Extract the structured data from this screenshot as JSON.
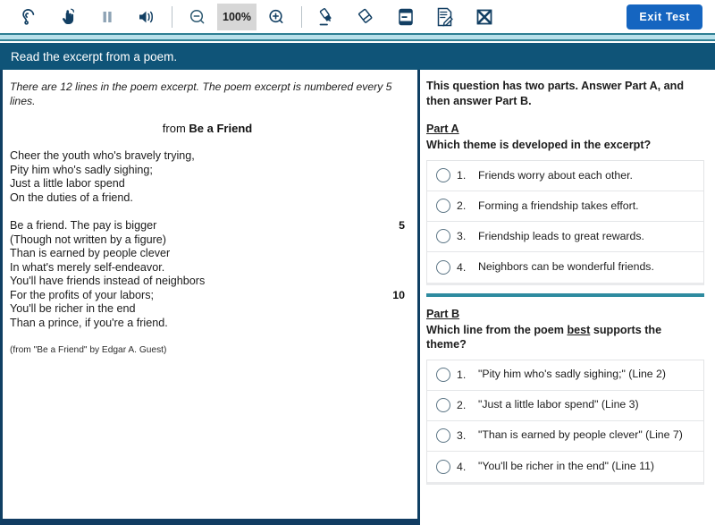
{
  "toolbar": {
    "tools": [
      {
        "name": "listen-icon",
        "label": "Listen"
      },
      {
        "name": "pointer-hand-icon",
        "label": "Pointer"
      },
      {
        "name": "pause-icon",
        "label": "Pause"
      },
      {
        "name": "volume-icon",
        "label": "Volume"
      },
      {
        "name": "zoom-out-icon",
        "label": "Zoom Out"
      },
      {
        "name": "zoom-in-icon",
        "label": "Zoom In"
      },
      {
        "name": "highlighter-icon",
        "label": "Highlighter"
      },
      {
        "name": "eraser-icon",
        "label": "Eraser"
      },
      {
        "name": "line-reader-icon",
        "label": "Line Reader"
      },
      {
        "name": "notepad-icon",
        "label": "Notepad"
      },
      {
        "name": "cross-out-icon",
        "label": "Cross Out"
      }
    ],
    "zoom_level": "100%",
    "exit_test_label": "Exit Test",
    "accent_color": "#1565c0",
    "icon_color": "#123f63"
  },
  "question_header": {
    "title": "Read the excerpt from a poem.",
    "background_color": "#0f5478"
  },
  "passage": {
    "note": "There are 12 lines in the poem excerpt. The poem excerpt is numbered every 5 lines.",
    "title_prefix": "from ",
    "title": "Be a Friend",
    "lines": [
      {
        "text": "Cheer the youth who's bravely trying,",
        "number": ""
      },
      {
        "text": "Pity him who's sadly sighing;",
        "number": ""
      },
      {
        "text": "Just a little labor spend",
        "number": ""
      },
      {
        "text": "On the duties of a friend.",
        "number": ""
      },
      {
        "text": "",
        "number": ""
      },
      {
        "text": "Be a friend. The pay is bigger",
        "number": "5"
      },
      {
        "text": "(Though not written by a figure)",
        "number": ""
      },
      {
        "text": "Than is earned by people clever",
        "number": ""
      },
      {
        "text": "In what's merely self-endeavor.",
        "number": ""
      },
      {
        "text": "You'll have friends instead of neighbors",
        "number": ""
      },
      {
        "text": "For the profits of your labors;",
        "number": "10"
      },
      {
        "text": "You'll be richer in the end",
        "number": ""
      },
      {
        "text": "Than a prince, if you're a friend.",
        "number": ""
      }
    ],
    "attribution": "(from \"Be a Friend\" by Edgar A. Guest)"
  },
  "question": {
    "intro": "This question has two parts. Answer Part A, and then answer Part B.",
    "part_a": {
      "label": "Part A",
      "prompt": "Which theme is developed in the excerpt?",
      "options": [
        {
          "number": "1.",
          "text": "Friends worry about each other."
        },
        {
          "number": "2.",
          "text": "Forming a friendship takes effort."
        },
        {
          "number": "3.",
          "text": "Friendship leads to great rewards."
        },
        {
          "number": "4.",
          "text": "Neighbors can be wonderful friends."
        }
      ]
    },
    "part_b": {
      "label": "Part B",
      "prompt_before": "Which line from the poem ",
      "prompt_emphasis": "best",
      "prompt_after": " supports the theme?",
      "options": [
        {
          "number": "1.",
          "text": "\"Pity him who's sadly sighing;\" (Line 2)"
        },
        {
          "number": "2.",
          "text": "\"Just a little labor spend\" (Line 3)"
        },
        {
          "number": "3.",
          "text": "\"Than is earned by people clever\" (Line 7)"
        },
        {
          "number": "4.",
          "text": "\"You'll be richer in the end\" (Line 11)"
        }
      ]
    },
    "divider_color": "#2e8ba0"
  }
}
